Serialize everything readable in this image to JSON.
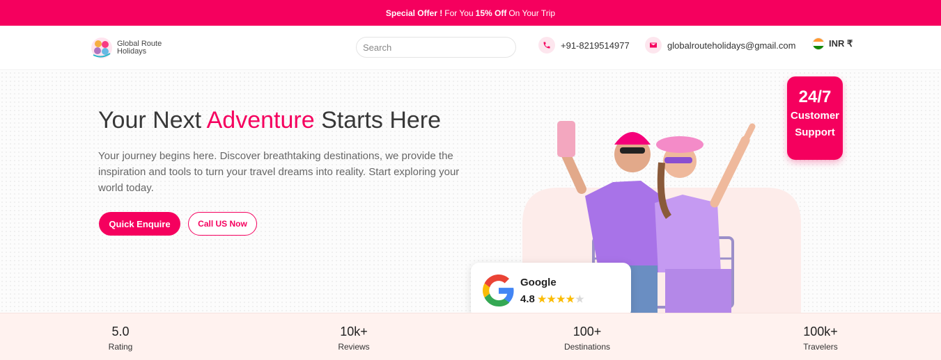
{
  "offer": {
    "lead": "Special Offer !",
    "mid": "For You",
    "discount": "15% Off",
    "tail": "On Your Trip"
  },
  "brand": {
    "name_line1": "Global Route",
    "name_line2": "Holidays"
  },
  "search": {
    "placeholder": "Search",
    "value": ""
  },
  "contact": {
    "phone": "+91-8219514977",
    "email": "globalrouteholidays@gmail.com"
  },
  "currency": {
    "label": "INR ₹"
  },
  "hero": {
    "title_before": "Your Next ",
    "title_accent": "Adventure",
    "title_after": " Starts Here",
    "description": "Your journey begins here. Discover breathtaking destinations, we provide the inspiration and tools to turn your travel dreams into reality. Start exploring your world today.",
    "primary_cta": "Quick Enquire",
    "secondary_cta": "Call US Now"
  },
  "support": {
    "line1": "24/7",
    "line2": "Customer",
    "line3": "Support"
  },
  "google": {
    "name": "Google",
    "rating": "4.8",
    "stars_filled": 4,
    "stars_total": 5
  },
  "stats": [
    {
      "value": "5.0",
      "label": "Rating"
    },
    {
      "value": "10k+",
      "label": "Reviews"
    },
    {
      "value": "100+",
      "label": "Destinations"
    },
    {
      "value": "100k+",
      "label": "Travelers"
    }
  ],
  "colors": {
    "brand_pink": "#f5005e",
    "stats_bg": "#fff2ef",
    "star": "#fbbc05"
  },
  "icons": {
    "phone": "phone-icon",
    "email": "mail-icon",
    "flag": "india-flag-icon",
    "google": "google-g-icon"
  }
}
